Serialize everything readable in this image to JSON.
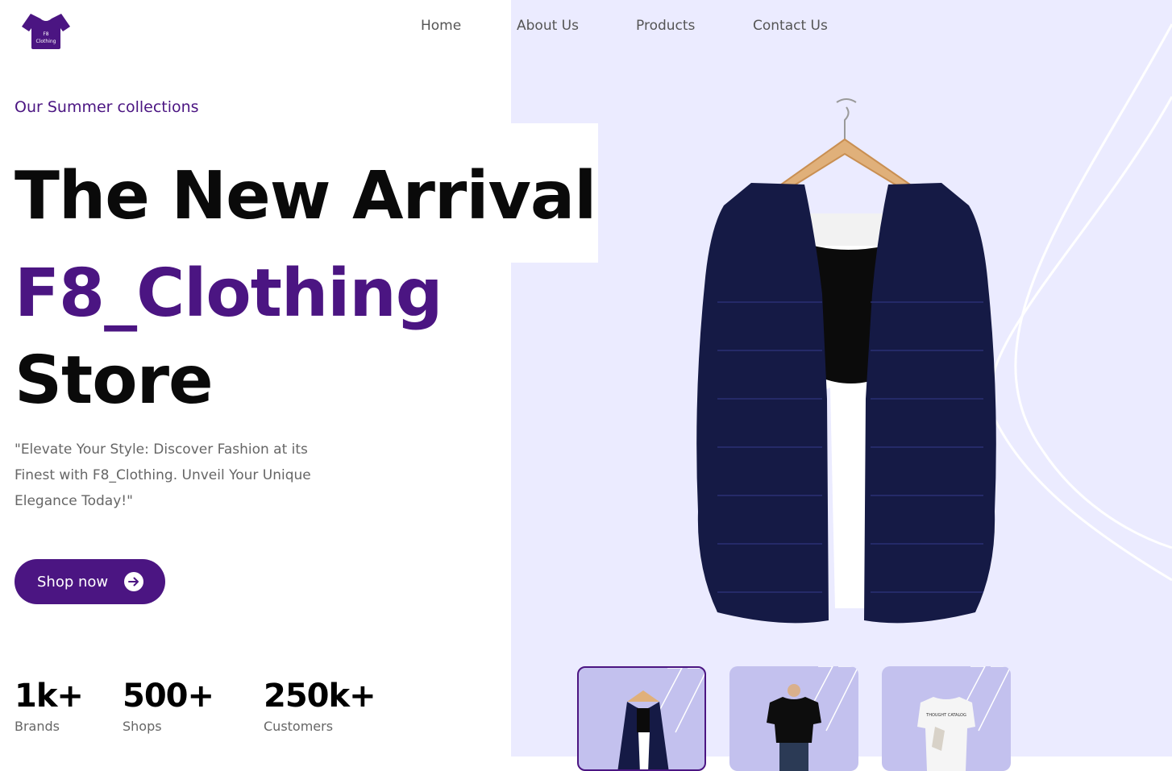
{
  "brand": {
    "logo_line1": "F8",
    "logo_line2": "Clothing"
  },
  "nav": {
    "items": [
      "Home",
      "About Us",
      "Products",
      "Contact Us"
    ]
  },
  "hero": {
    "eyebrow": "Our Summer collections",
    "title_line1": "The New Arrival",
    "title_line2": "F8_Clothing",
    "title_line3": "Store",
    "description": "\"Elevate Your Style: Discover Fashion at its Finest with F8_Clothing. Unveil Your Unique Elegance Today!\"",
    "cta_label": "Shop now"
  },
  "stats": [
    {
      "value": "1k+",
      "label": "Brands"
    },
    {
      "value": "500+",
      "label": "Shops"
    },
    {
      "value": "250k+",
      "label": "Customers"
    }
  ],
  "thumbnails": [
    {
      "name": "knit-vest",
      "active": true
    },
    {
      "name": "black-tshirt",
      "active": false
    },
    {
      "name": "white-printed-tshirt",
      "active": false,
      "print_text": "THOUGHT CATALOG"
    }
  ],
  "colors": {
    "accent": "#4b1582",
    "panel": "#ebebff",
    "thumb_bg": "#c3c1ee",
    "text_muted": "#666666"
  },
  "icons": {
    "cta_icon": "arrow-right-circle-icon",
    "logo": "tshirt-logo-icon"
  }
}
